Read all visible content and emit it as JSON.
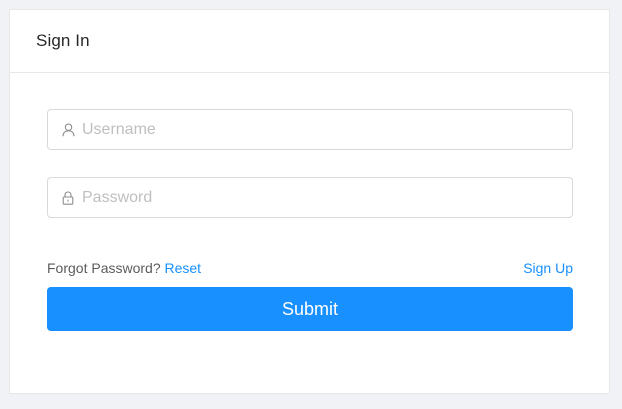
{
  "card": {
    "title": "Sign In"
  },
  "username": {
    "placeholder": "Username",
    "value": "",
    "icon": "user-icon"
  },
  "password": {
    "placeholder": "Password",
    "value": "",
    "icon": "lock-icon"
  },
  "links": {
    "forgot_text": "Forgot Password?",
    "reset_label": "Reset",
    "signup_label": "Sign Up"
  },
  "submit": {
    "label": "Submit"
  },
  "colors": {
    "primary": "#1890ff",
    "page_bg": "#f0f2f5",
    "border": "#d9d9d9",
    "placeholder": "#bfbfbf"
  }
}
